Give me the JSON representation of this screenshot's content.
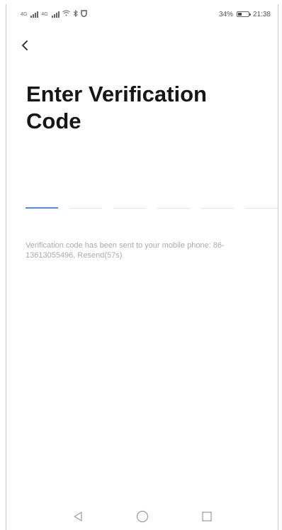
{
  "status_bar": {
    "sim1_label": "4G",
    "sim2_label": "4G",
    "battery_percent": "34%",
    "battery_level": 0.34,
    "time": "21:38"
  },
  "header": {
    "title": "Enter Verification Code"
  },
  "code_input": {
    "length": 6,
    "active_index": 0
  },
  "hint": {
    "text": "Verification code has been sent to your mobile phone: 86-13613055496, Resend(57s)"
  },
  "nav": {
    "back_icon": "triangle-back-icon",
    "home_icon": "circle-home-icon",
    "recent_icon": "square-recent-icon"
  },
  "colors": {
    "accent": "#4a8ed8",
    "hint": "#a9a9a9"
  }
}
